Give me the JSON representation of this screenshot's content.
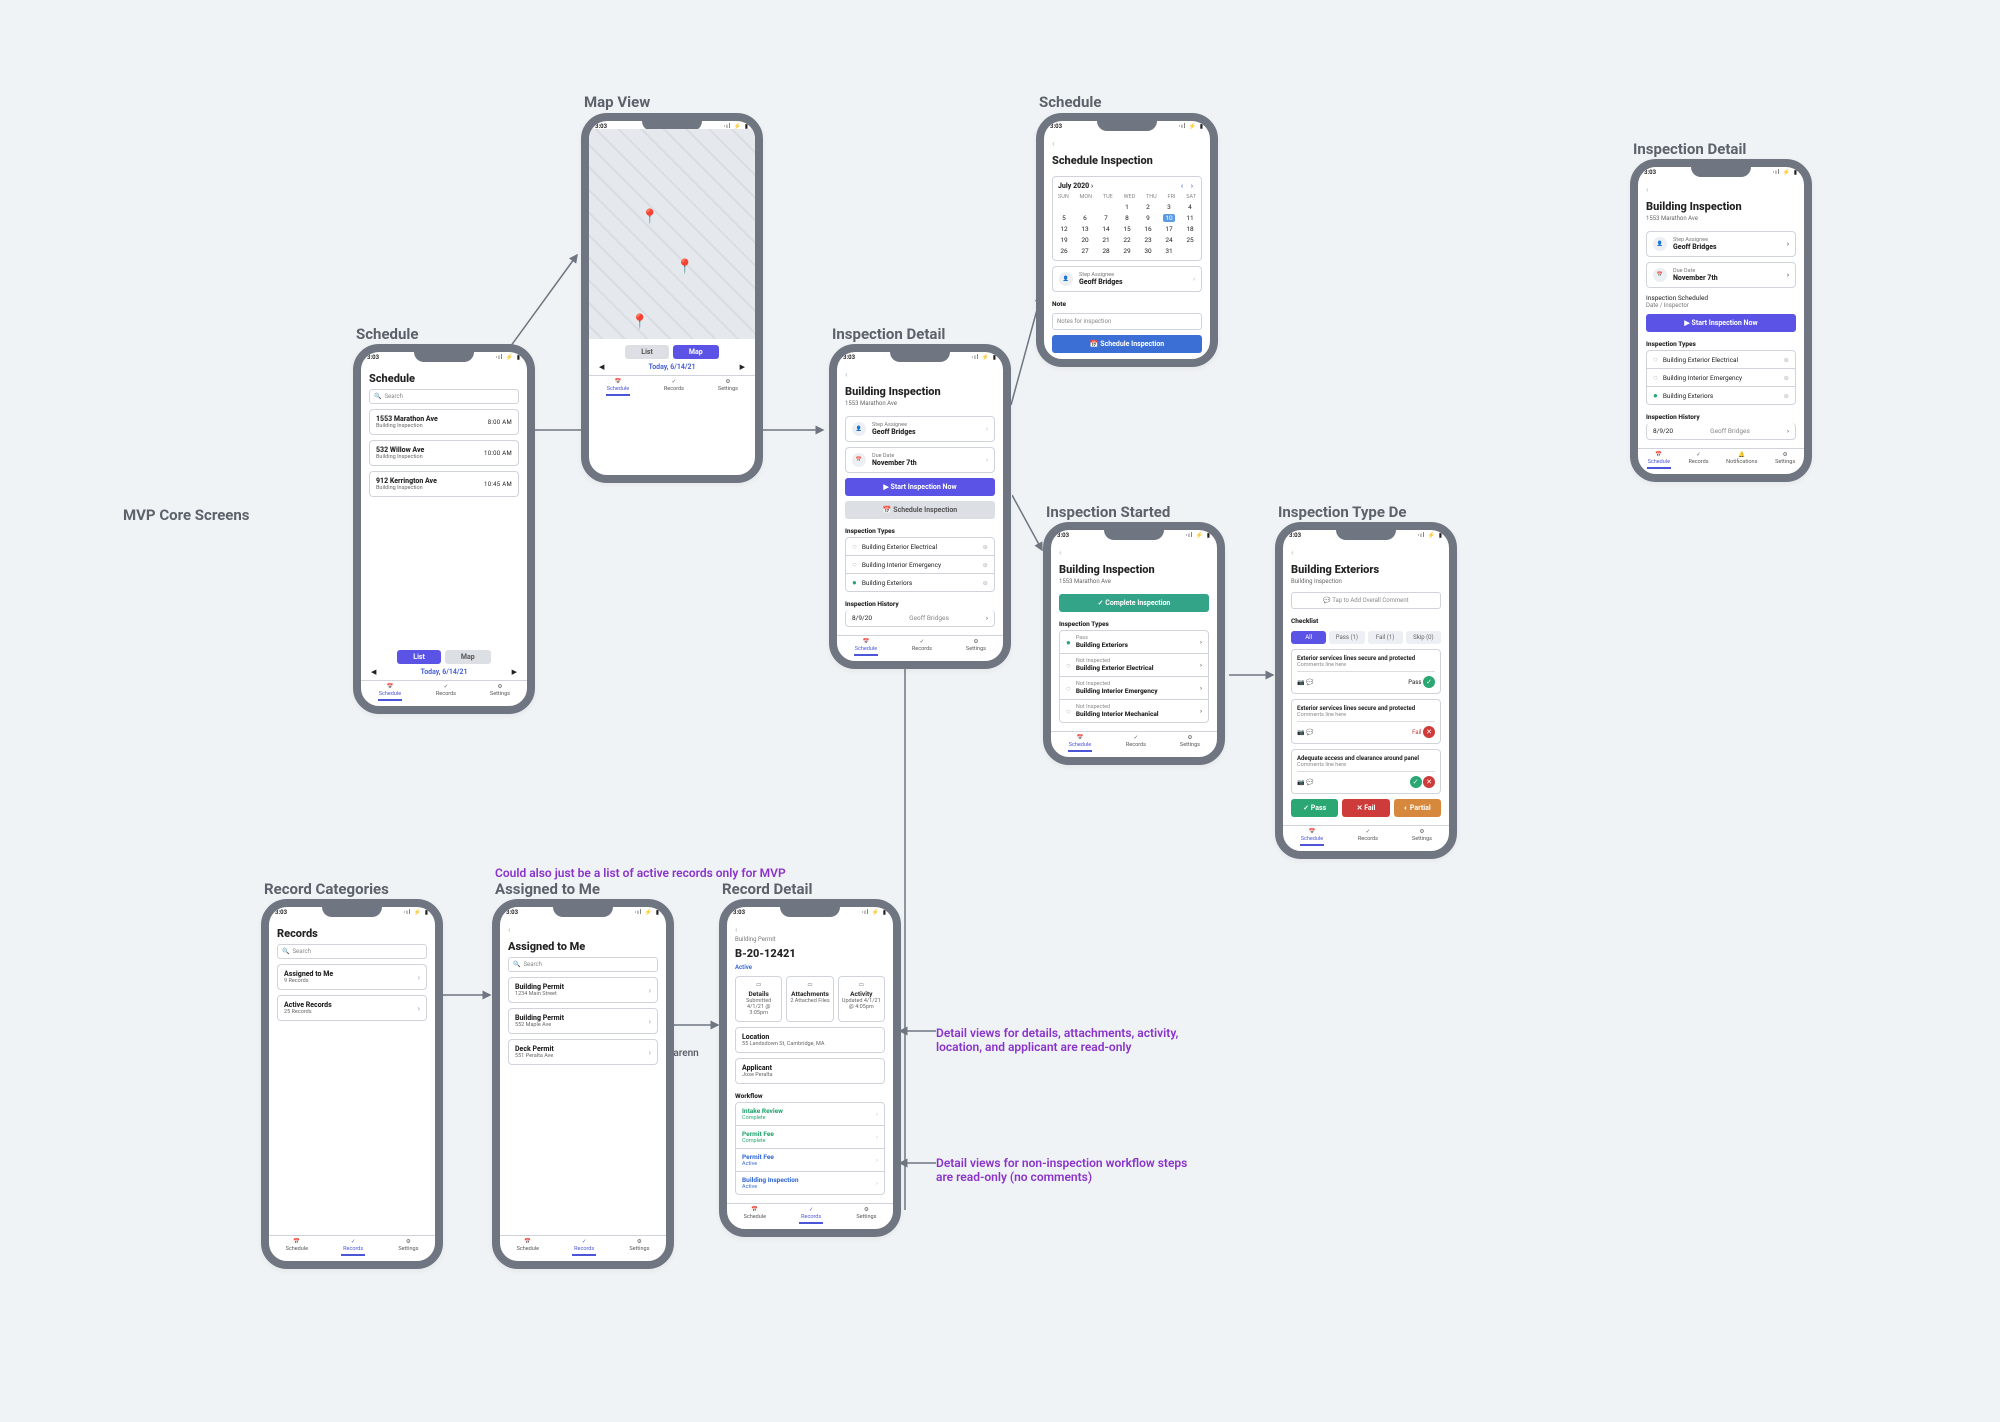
{
  "annotations": {
    "mvp": "MVP Core Screens",
    "schedule1": "Schedule",
    "mapview": "Map View",
    "inspdetail1": "Inspection Detail",
    "schedule2": "Schedule",
    "inspstarted": "Inspection Started",
    "insptype": "Inspection Type De",
    "inspdetail2": "Inspection Detail",
    "reccat": "Record Categories",
    "assignedme": "Assigned to Me",
    "recdetail": "Record Detail",
    "note_mvp": "Could also just be a list of active records only for MVP",
    "note_readonly1": "Detail views for details, attachments, activity, location, and applicant are read-only",
    "note_readonly2": "Detail views for non-inspection workflow steps are read-only (no comments)",
    "julia": "juliarenn"
  },
  "common": {
    "time": "3:03",
    "signal": "⋅ıl ⚡ ▮",
    "tab_schedule": "Schedule",
    "tab_records": "Records",
    "tab_settings": "Settings",
    "tab_notifications": "Notifications",
    "search_placeholder": "Search",
    "today": "Today, 6/14/21",
    "list_btn": "List",
    "map_btn": "Map"
  },
  "schedule_list": {
    "title": "Schedule",
    "items": [
      {
        "addr": "1553 Marathon Ave",
        "sub": "Building Inspection",
        "time": "8:00 AM"
      },
      {
        "addr": "532 Willow Ave",
        "sub": "Building Inspection",
        "time": "10:00 AM"
      },
      {
        "addr": "912 Kerrington Ave",
        "sub": "Building Inspection",
        "time": "10:45 AM"
      }
    ]
  },
  "insp_detail": {
    "title": "Building Inspection",
    "addr": "1553 Marathon Ave",
    "assignee_lbl": "Step Assignee",
    "assignee": "Geoff Bridges",
    "due_lbl": "Due Date",
    "due": "November 7th",
    "start_btn": "▶ Start Inspection Now",
    "sched_btn": "📅 Schedule Inspection",
    "types_lbl": "Inspection Types",
    "types": [
      {
        "n": "Building Exterior Electrical",
        "done": false
      },
      {
        "n": "Building Interior Emergency",
        "done": false
      },
      {
        "n": "Building Exteriors",
        "done": true
      }
    ],
    "hist_lbl": "Inspection History",
    "hist_date": "8/9/20",
    "hist_who": "Geoff Bridges",
    "sched_sub": "Inspection Scheduled",
    "sched_sub2": "Date / Inspector"
  },
  "schedule_cal": {
    "title": "Schedule Inspection",
    "month": "July 2020",
    "dow": [
      "SUN",
      "MON",
      "TUE",
      "WED",
      "THU",
      "FRI",
      "SAT"
    ],
    "weeks": [
      [
        "",
        "",
        "",
        "1",
        "2",
        "3",
        "4"
      ],
      [
        "5",
        "6",
        "7",
        "8",
        "9",
        "10",
        "11"
      ],
      [
        "12",
        "13",
        "14",
        "15",
        "16",
        "17",
        "18"
      ],
      [
        "19",
        "20",
        "21",
        "22",
        "23",
        "24",
        "25"
      ],
      [
        "26",
        "27",
        "28",
        "29",
        "30",
        "31",
        ""
      ]
    ],
    "selected": "10",
    "note_lbl": "Note",
    "note_ph": "Notes for inspection",
    "btn": "📅  Schedule Inspection"
  },
  "insp_started": {
    "title": "Building Inspection",
    "addr": "1553 Marathon Ave",
    "btn": "✓ Complete Inspection",
    "types_lbl": "Inspection Types",
    "rows": [
      {
        "s": "Pass",
        "n": "Building Exteriors",
        "pass": true
      },
      {
        "s": "Not Inspected",
        "n": "Building Exterior Electrical",
        "pass": false
      },
      {
        "s": "Not Inspected",
        "n": "Building Interior Emergency",
        "pass": false
      },
      {
        "s": "Not Inspected",
        "n": "Building Interior Mechanical",
        "pass": false
      }
    ]
  },
  "insp_type": {
    "title": "Building Exteriors",
    "sub": "Building Inspection",
    "addcomment": "Tap to Add Overall Comment",
    "checklist_lbl": "Checklist",
    "filters": [
      "All",
      "Pass (1)",
      "Fail (1)",
      "Skip (0)"
    ],
    "items": [
      {
        "q": "Exterior services lines secure and protected",
        "note": "Comments line here",
        "result": "Pass"
      },
      {
        "q": "Exterior services lines secure and protected",
        "note": "Comments line here",
        "result": "Fail"
      },
      {
        "q": "Adequate access and clearance around panel",
        "note": "Comments line here",
        "result": ""
      }
    ],
    "pass": "Pass",
    "fail": "Fail",
    "partial": "Partial"
  },
  "records": {
    "title": "Records",
    "cats": [
      {
        "n": "Assigned to Me",
        "s": "9 Records"
      },
      {
        "n": "Active Records",
        "s": "25 Records"
      }
    ]
  },
  "assigned": {
    "title": "Assigned to Me",
    "items": [
      {
        "n": "Building Permit",
        "s": "1234 Main Street"
      },
      {
        "n": "Building Permit",
        "s": "552 Maple Ave"
      },
      {
        "n": "Deck Permit",
        "s": "551 Peralta Ave"
      }
    ]
  },
  "rec_detail": {
    "crumb": "Building Permit",
    "id": "B-20-12421",
    "status": "Active",
    "tiles": [
      {
        "t": "Details",
        "s": "Submitted 4/1/21 @ 3:05pm"
      },
      {
        "t": "Attachments",
        "s": "2 Attached Files"
      },
      {
        "t": "Activity",
        "s": "Updated 4/1/21 @ 4:05pm"
      }
    ],
    "loc_lbl": "Location",
    "loc": "55 Landsdown St, Cambridge, MA",
    "app_lbl": "Applicant",
    "app": "Jose Peralta",
    "wf_lbl": "Workflow",
    "wf": [
      {
        "n": "Intake Review",
        "s": "Complete",
        "c": "#2aa773"
      },
      {
        "n": "Permit Fee",
        "s": "Complete",
        "c": "#2aa773"
      },
      {
        "n": "Permit Fee",
        "s": "Active",
        "c": "#3b6fd6"
      },
      {
        "n": "Building Inspection",
        "s": "Active",
        "c": "#3b6fd6"
      }
    ]
  }
}
